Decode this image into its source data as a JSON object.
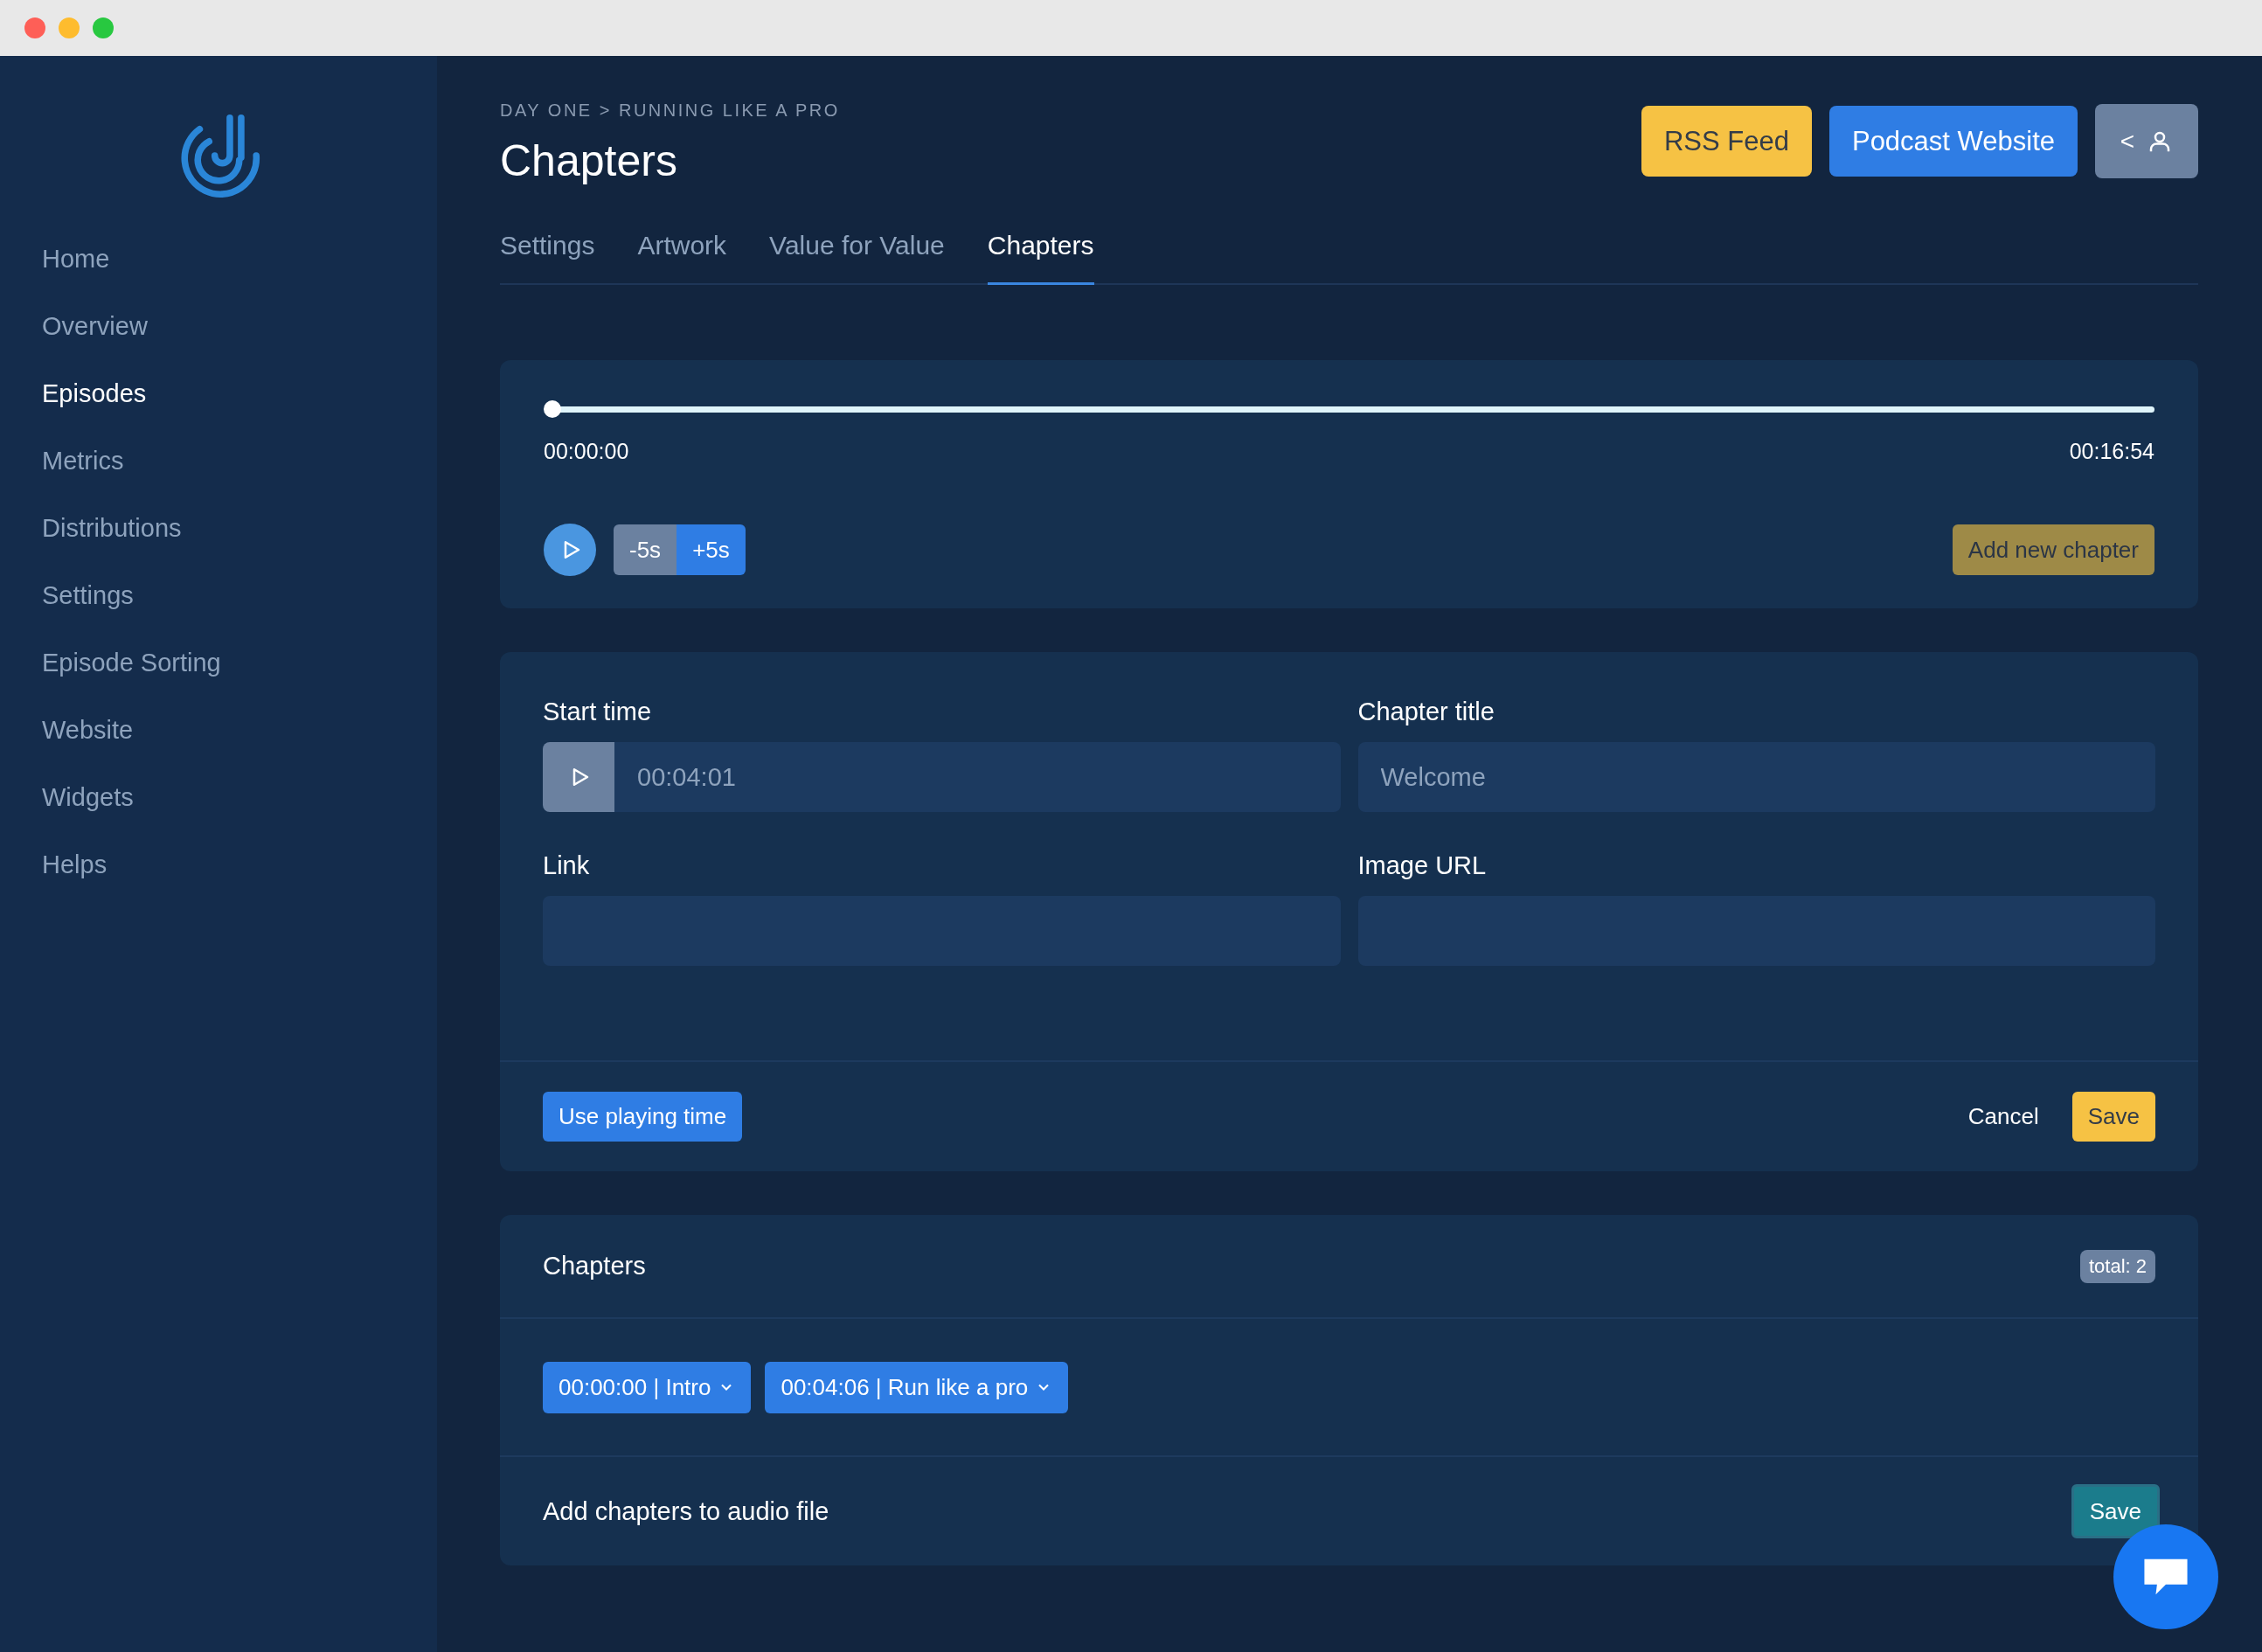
{
  "sidebar": {
    "items": [
      {
        "label": "Home",
        "selected": false
      },
      {
        "label": "Overview",
        "selected": false
      },
      {
        "label": "Episodes",
        "selected": true
      },
      {
        "label": "Metrics",
        "selected": false
      },
      {
        "label": "Distributions",
        "selected": false
      },
      {
        "label": "Settings",
        "selected": false
      },
      {
        "label": "Episode Sorting",
        "selected": false
      },
      {
        "label": "Website",
        "selected": false
      },
      {
        "label": "Widgets",
        "selected": false
      },
      {
        "label": "Helps",
        "selected": false
      }
    ]
  },
  "header": {
    "breadcrumb": "DAY ONE > RUNNING LIKE A PRO",
    "title": "Chapters",
    "buttons": [
      {
        "label": "RSS Feed",
        "kind": "warning"
      },
      {
        "label": "Podcast Website",
        "kind": "primary"
      },
      {
        "label": "<",
        "kind": "user"
      }
    ]
  },
  "tabs": [
    {
      "label": "Settings",
      "selected": false
    },
    {
      "label": "Artwork",
      "selected": false
    },
    {
      "label": "Value for Value",
      "selected": false
    },
    {
      "label": "Chapters",
      "selected": true
    }
  ],
  "player": {
    "level": 0,
    "current_time": "00:00:00",
    "duration": "00:16:54",
    "skip_buttons": [
      {
        "label": "-5s",
        "kind": "secondary"
      },
      {
        "label": "+5s",
        "kind": "primary"
      }
    ],
    "add_button": "Add new chapter"
  },
  "form": {
    "fields": [
      {
        "label": "Start time",
        "value": "00:04:01",
        "kind": "time"
      },
      {
        "label": "Chapter title",
        "value": "Welcome",
        "kind": "text"
      },
      {
        "label": "Link",
        "kind": "text"
      },
      {
        "label": "Image URL",
        "kind": "text"
      }
    ],
    "use_time_button": "Use playing time",
    "cancel": "Cancel",
    "save": "Save"
  },
  "chapters": {
    "title": "Chapters",
    "total": "total: 2",
    "items": [
      {
        "label": "00:00:00 | Intro"
      },
      {
        "label": "00:04:06 | Run like a pro"
      }
    ],
    "footer_text": "Add chapters to audio file",
    "save": "Save"
  }
}
